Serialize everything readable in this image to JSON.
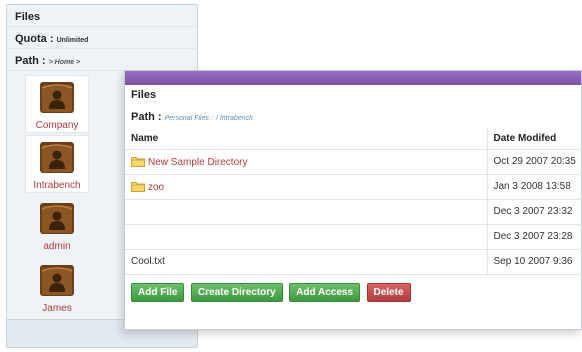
{
  "back_panel": {
    "title": "Files",
    "quota_label": "Quota :",
    "quota_value": "Unlimited",
    "path_label": "Path :",
    "path_value": "> Home >",
    "folders": [
      {
        "label": "Company"
      },
      {
        "label": "Intrabench"
      },
      {
        "label": "admin"
      },
      {
        "label": "James"
      }
    ]
  },
  "front_panel": {
    "title": "Files",
    "path_label": "Path :",
    "path_part1": "Personal Files :",
    "path_part2": "/ Intrabench",
    "columns": {
      "name": "Name",
      "date": "Date Modifed"
    },
    "rows": [
      {
        "name": "New Sample Directory",
        "date": "Oct 29 2007 20:35",
        "type": "folder"
      },
      {
        "name": "zoo",
        "date": "Jan 3 2008 13:58",
        "type": "folder"
      },
      {
        "name": "",
        "date": "Dec 3 2007 23:32",
        "type": "empty"
      },
      {
        "name": "",
        "date": "Dec 3 2007 23:28",
        "type": "empty"
      },
      {
        "name": "Cool.txt",
        "date": "Sep 10 2007 9:36",
        "type": "file"
      }
    ],
    "buttons": {
      "add_file": "Add File",
      "create_directory": "Create Directory",
      "add_access": "Add Access",
      "delete": "Delete"
    }
  },
  "colors": {
    "header_bar": "#7c52a8",
    "button_green": "#3e9a3e",
    "button_red": "#b03e3e",
    "folder_label": "#b23a3a"
  }
}
